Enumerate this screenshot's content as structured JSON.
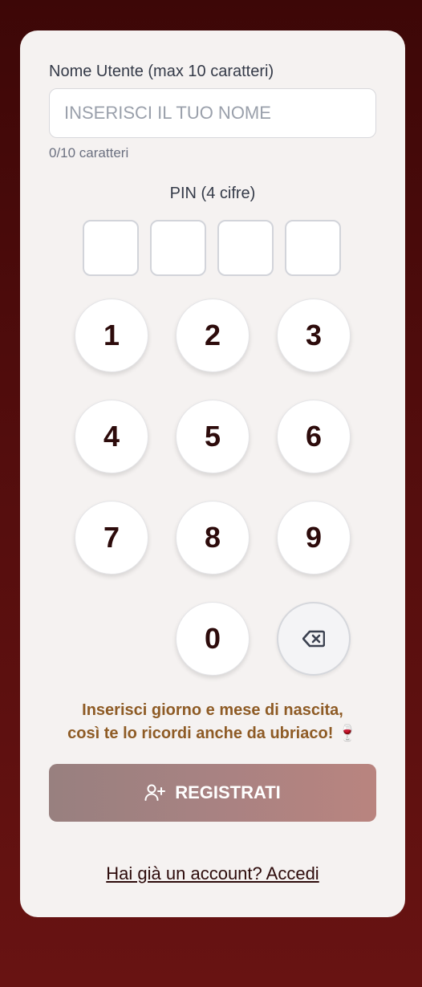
{
  "form": {
    "username_label": "Nome Utente (max 10 caratteri)",
    "username_value": "",
    "username_placeholder": "INSERISCI IL TUO NOME",
    "char_count": "0/10 caratteri",
    "pin_label": "PIN (4 cifre)",
    "pin_digits": [
      "",
      "",
      "",
      ""
    ]
  },
  "keypad": {
    "keys": [
      "1",
      "2",
      "3",
      "4",
      "5",
      "6",
      "7",
      "8",
      "9",
      "0"
    ],
    "backspace_icon": "backspace-icon"
  },
  "hint": {
    "line1": "Inserisci giorno e mese di nascita,",
    "line2": "così te lo ricordi anche da ubriaco! 🍷"
  },
  "actions": {
    "register_label": "REGISTRATI",
    "register_icon": "user-plus-icon",
    "login_link": "Hai già un account? Accedi"
  },
  "colors": {
    "background": "#530d0d",
    "card": "#f5f2f1",
    "hint_text": "#8e5b25",
    "register_button_start": "#98807f",
    "register_button_end": "#b9847f",
    "key_text": "#2d0b0b"
  }
}
